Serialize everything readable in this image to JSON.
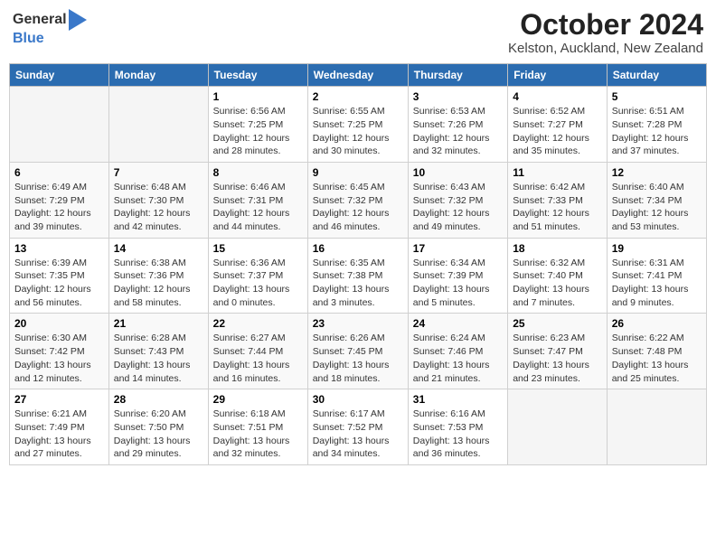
{
  "header": {
    "logo_general": "General",
    "logo_blue": "Blue",
    "month": "October 2024",
    "location": "Kelston, Auckland, New Zealand"
  },
  "weekdays": [
    "Sunday",
    "Monday",
    "Tuesday",
    "Wednesday",
    "Thursday",
    "Friday",
    "Saturday"
  ],
  "weeks": [
    [
      {
        "day": "",
        "info": ""
      },
      {
        "day": "",
        "info": ""
      },
      {
        "day": "1",
        "info": "Sunrise: 6:56 AM\nSunset: 7:25 PM\nDaylight: 12 hours and 28 minutes."
      },
      {
        "day": "2",
        "info": "Sunrise: 6:55 AM\nSunset: 7:25 PM\nDaylight: 12 hours and 30 minutes."
      },
      {
        "day": "3",
        "info": "Sunrise: 6:53 AM\nSunset: 7:26 PM\nDaylight: 12 hours and 32 minutes."
      },
      {
        "day": "4",
        "info": "Sunrise: 6:52 AM\nSunset: 7:27 PM\nDaylight: 12 hours and 35 minutes."
      },
      {
        "day": "5",
        "info": "Sunrise: 6:51 AM\nSunset: 7:28 PM\nDaylight: 12 hours and 37 minutes."
      }
    ],
    [
      {
        "day": "6",
        "info": "Sunrise: 6:49 AM\nSunset: 7:29 PM\nDaylight: 12 hours and 39 minutes."
      },
      {
        "day": "7",
        "info": "Sunrise: 6:48 AM\nSunset: 7:30 PM\nDaylight: 12 hours and 42 minutes."
      },
      {
        "day": "8",
        "info": "Sunrise: 6:46 AM\nSunset: 7:31 PM\nDaylight: 12 hours and 44 minutes."
      },
      {
        "day": "9",
        "info": "Sunrise: 6:45 AM\nSunset: 7:32 PM\nDaylight: 12 hours and 46 minutes."
      },
      {
        "day": "10",
        "info": "Sunrise: 6:43 AM\nSunset: 7:32 PM\nDaylight: 12 hours and 49 minutes."
      },
      {
        "day": "11",
        "info": "Sunrise: 6:42 AM\nSunset: 7:33 PM\nDaylight: 12 hours and 51 minutes."
      },
      {
        "day": "12",
        "info": "Sunrise: 6:40 AM\nSunset: 7:34 PM\nDaylight: 12 hours and 53 minutes."
      }
    ],
    [
      {
        "day": "13",
        "info": "Sunrise: 6:39 AM\nSunset: 7:35 PM\nDaylight: 12 hours and 56 minutes."
      },
      {
        "day": "14",
        "info": "Sunrise: 6:38 AM\nSunset: 7:36 PM\nDaylight: 12 hours and 58 minutes."
      },
      {
        "day": "15",
        "info": "Sunrise: 6:36 AM\nSunset: 7:37 PM\nDaylight: 13 hours and 0 minutes."
      },
      {
        "day": "16",
        "info": "Sunrise: 6:35 AM\nSunset: 7:38 PM\nDaylight: 13 hours and 3 minutes."
      },
      {
        "day": "17",
        "info": "Sunrise: 6:34 AM\nSunset: 7:39 PM\nDaylight: 13 hours and 5 minutes."
      },
      {
        "day": "18",
        "info": "Sunrise: 6:32 AM\nSunset: 7:40 PM\nDaylight: 13 hours and 7 minutes."
      },
      {
        "day": "19",
        "info": "Sunrise: 6:31 AM\nSunset: 7:41 PM\nDaylight: 13 hours and 9 minutes."
      }
    ],
    [
      {
        "day": "20",
        "info": "Sunrise: 6:30 AM\nSunset: 7:42 PM\nDaylight: 13 hours and 12 minutes."
      },
      {
        "day": "21",
        "info": "Sunrise: 6:28 AM\nSunset: 7:43 PM\nDaylight: 13 hours and 14 minutes."
      },
      {
        "day": "22",
        "info": "Sunrise: 6:27 AM\nSunset: 7:44 PM\nDaylight: 13 hours and 16 minutes."
      },
      {
        "day": "23",
        "info": "Sunrise: 6:26 AM\nSunset: 7:45 PM\nDaylight: 13 hours and 18 minutes."
      },
      {
        "day": "24",
        "info": "Sunrise: 6:24 AM\nSunset: 7:46 PM\nDaylight: 13 hours and 21 minutes."
      },
      {
        "day": "25",
        "info": "Sunrise: 6:23 AM\nSunset: 7:47 PM\nDaylight: 13 hours and 23 minutes."
      },
      {
        "day": "26",
        "info": "Sunrise: 6:22 AM\nSunset: 7:48 PM\nDaylight: 13 hours and 25 minutes."
      }
    ],
    [
      {
        "day": "27",
        "info": "Sunrise: 6:21 AM\nSunset: 7:49 PM\nDaylight: 13 hours and 27 minutes."
      },
      {
        "day": "28",
        "info": "Sunrise: 6:20 AM\nSunset: 7:50 PM\nDaylight: 13 hours and 29 minutes."
      },
      {
        "day": "29",
        "info": "Sunrise: 6:18 AM\nSunset: 7:51 PM\nDaylight: 13 hours and 32 minutes."
      },
      {
        "day": "30",
        "info": "Sunrise: 6:17 AM\nSunset: 7:52 PM\nDaylight: 13 hours and 34 minutes."
      },
      {
        "day": "31",
        "info": "Sunrise: 6:16 AM\nSunset: 7:53 PM\nDaylight: 13 hours and 36 minutes."
      },
      {
        "day": "",
        "info": ""
      },
      {
        "day": "",
        "info": ""
      }
    ]
  ]
}
